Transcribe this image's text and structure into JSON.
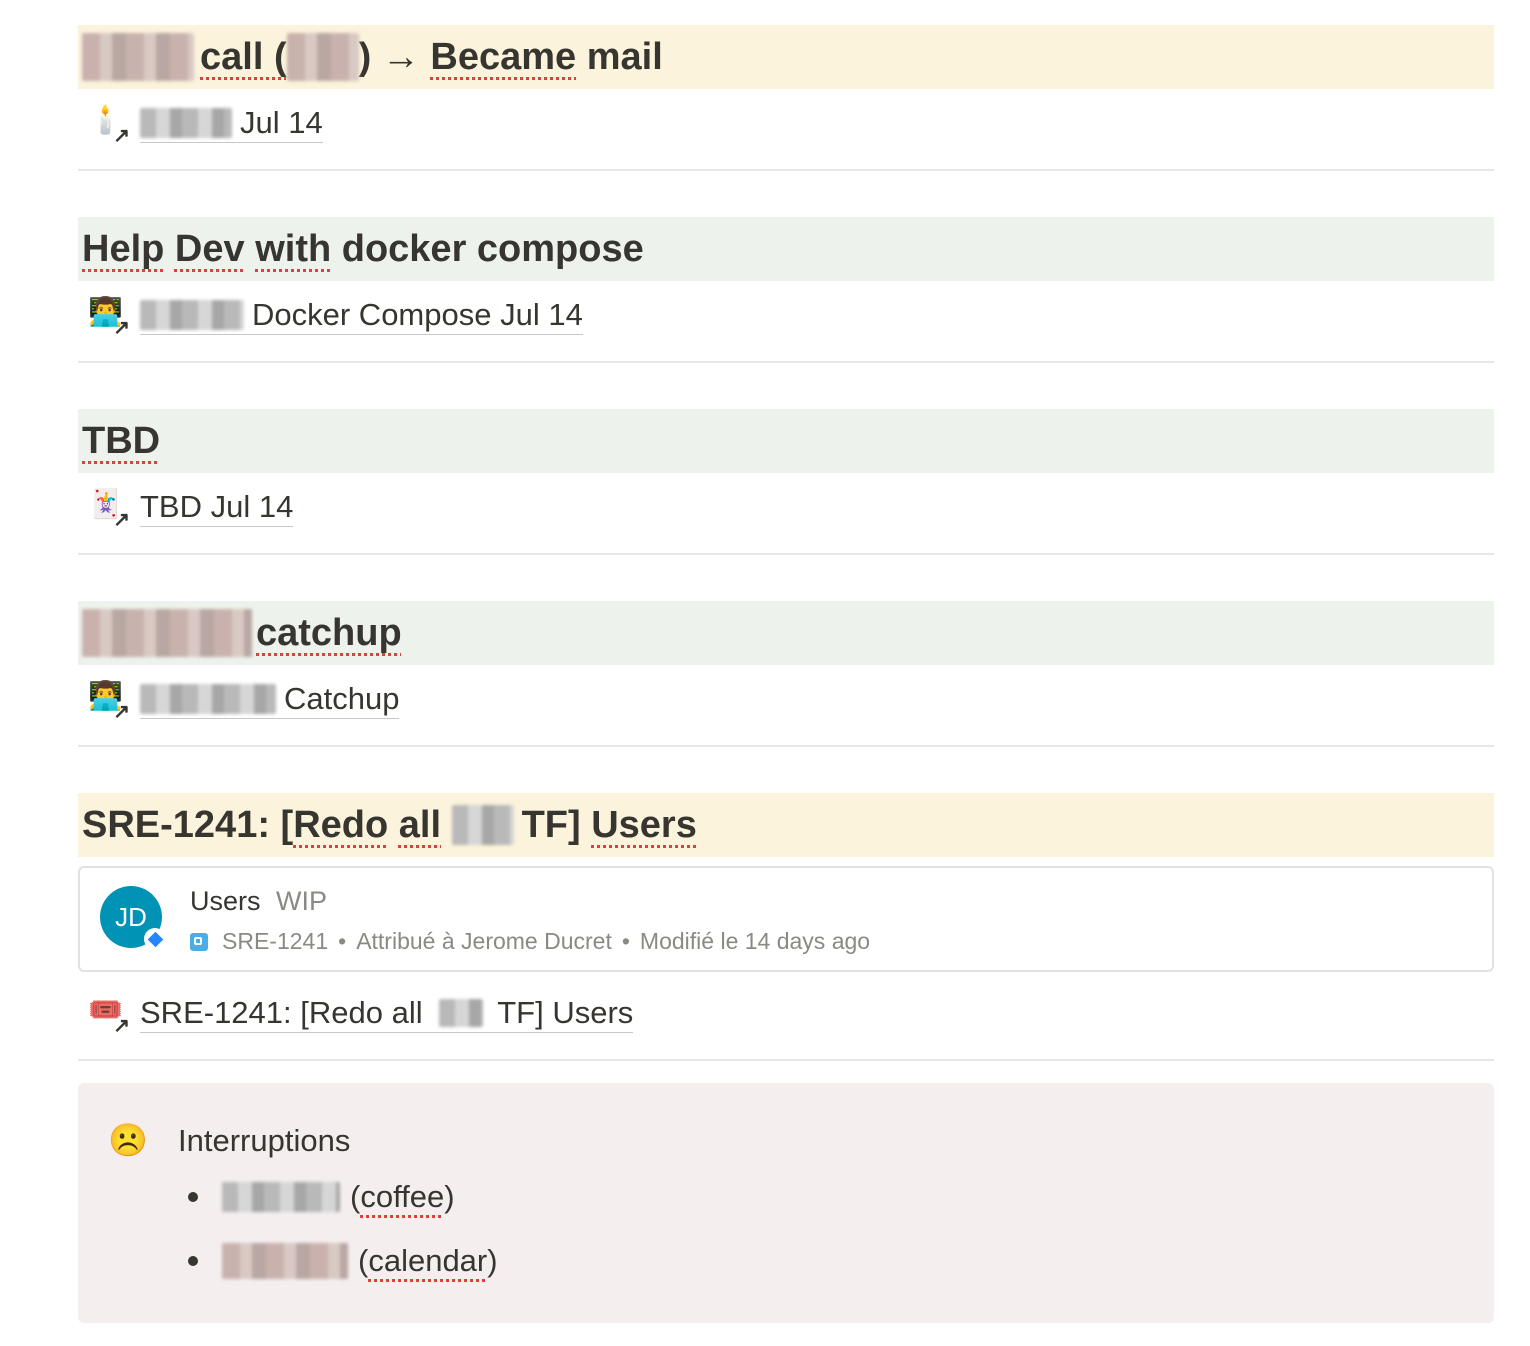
{
  "sections": [
    {
      "heading_parts": [
        "call (",
        ") → ",
        "Became",
        " mail"
      ],
      "link_text": "Jul 14",
      "link_icon": "candle-icon"
    },
    {
      "heading_parts": [
        "Help",
        " ",
        "Dev",
        " ",
        "with",
        " docker compose"
      ],
      "link_text": "Docker Compose Jul 14",
      "link_icon": "technologist-icon"
    },
    {
      "heading": "TBD",
      "link_text": "TBD Jul 14",
      "link_icon": "joker-card-icon"
    },
    {
      "heading": "catchup",
      "link_text": "Catchup",
      "link_icon": "technologist-icon"
    },
    {
      "heading_parts": [
        "SRE-1241: [",
        "Redo",
        " ",
        "all",
        " ",
        "TF] ",
        "Users"
      ],
      "link_text_parts": [
        "SRE-1241: [Redo all ",
        "TF] Users"
      ],
      "link_icon": "ticket-icon"
    }
  ],
  "jira_card": {
    "avatar_initials": "JD",
    "title": "Users",
    "status": "WIP",
    "issue_key": "SRE-1241",
    "sep1": "•",
    "assigned": "Attribué à Jerome Ducret",
    "sep2": "•",
    "modified": "Modifié le 14 days ago",
    "avatar_color": "#0093b5",
    "issue_icon_color": "#4bade8"
  },
  "callout": {
    "emoji": "☹️",
    "title": "Interruptions",
    "items": [
      {
        "text_pre": "(",
        "text_word": "coffee",
        "text_post": ")"
      },
      {
        "text_pre": "(",
        "text_word": "calendar",
        "text_post": ")"
      }
    ],
    "background": "#f4eeee"
  },
  "colors": {
    "highlight_yellow": "#fbf3db",
    "highlight_green": "#edf3ec",
    "spellcheck": "#e03e3e"
  },
  "icons": {
    "candle": "🕯️",
    "technologist": "👨‍💻",
    "joker": "🃏",
    "ticket": "🎟️",
    "link_arrow": "↗"
  }
}
